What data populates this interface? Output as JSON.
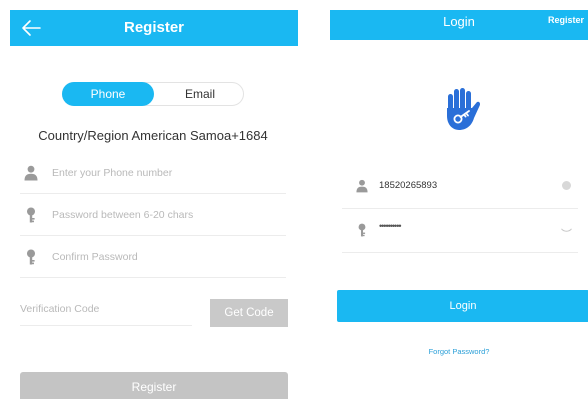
{
  "register": {
    "title": "Register",
    "tabs": {
      "phone": "Phone",
      "email": "Email",
      "selected": "Phone"
    },
    "country_line": "Country/Region American Samoa+1684",
    "phone_placeholder": "Enter your Phone number",
    "password_placeholder": "Password between 6-20 chars",
    "confirm_placeholder": "Confirm Password",
    "code_placeholder": "Verification Code",
    "get_code_label": "Get Code",
    "submit_label": "Register"
  },
  "login": {
    "title": "Login",
    "register_link": "Register",
    "phone_value": "18520265893",
    "password_masked": "••••••••••",
    "submit_label": "Login",
    "forgot_label": "Forgot Password?"
  },
  "colors": {
    "accent": "#1ab8f2",
    "disabled": "#c4c4c4",
    "icon_gray": "#9a9a9a",
    "logo_blue": "#2a6fd8"
  },
  "icons": {
    "back": "arrow-left-icon",
    "user": "user-icon",
    "password": "key-icon",
    "clear": "clear-circle-icon",
    "eye": "eye-closed-icon",
    "logo": "hand-key-logo"
  }
}
